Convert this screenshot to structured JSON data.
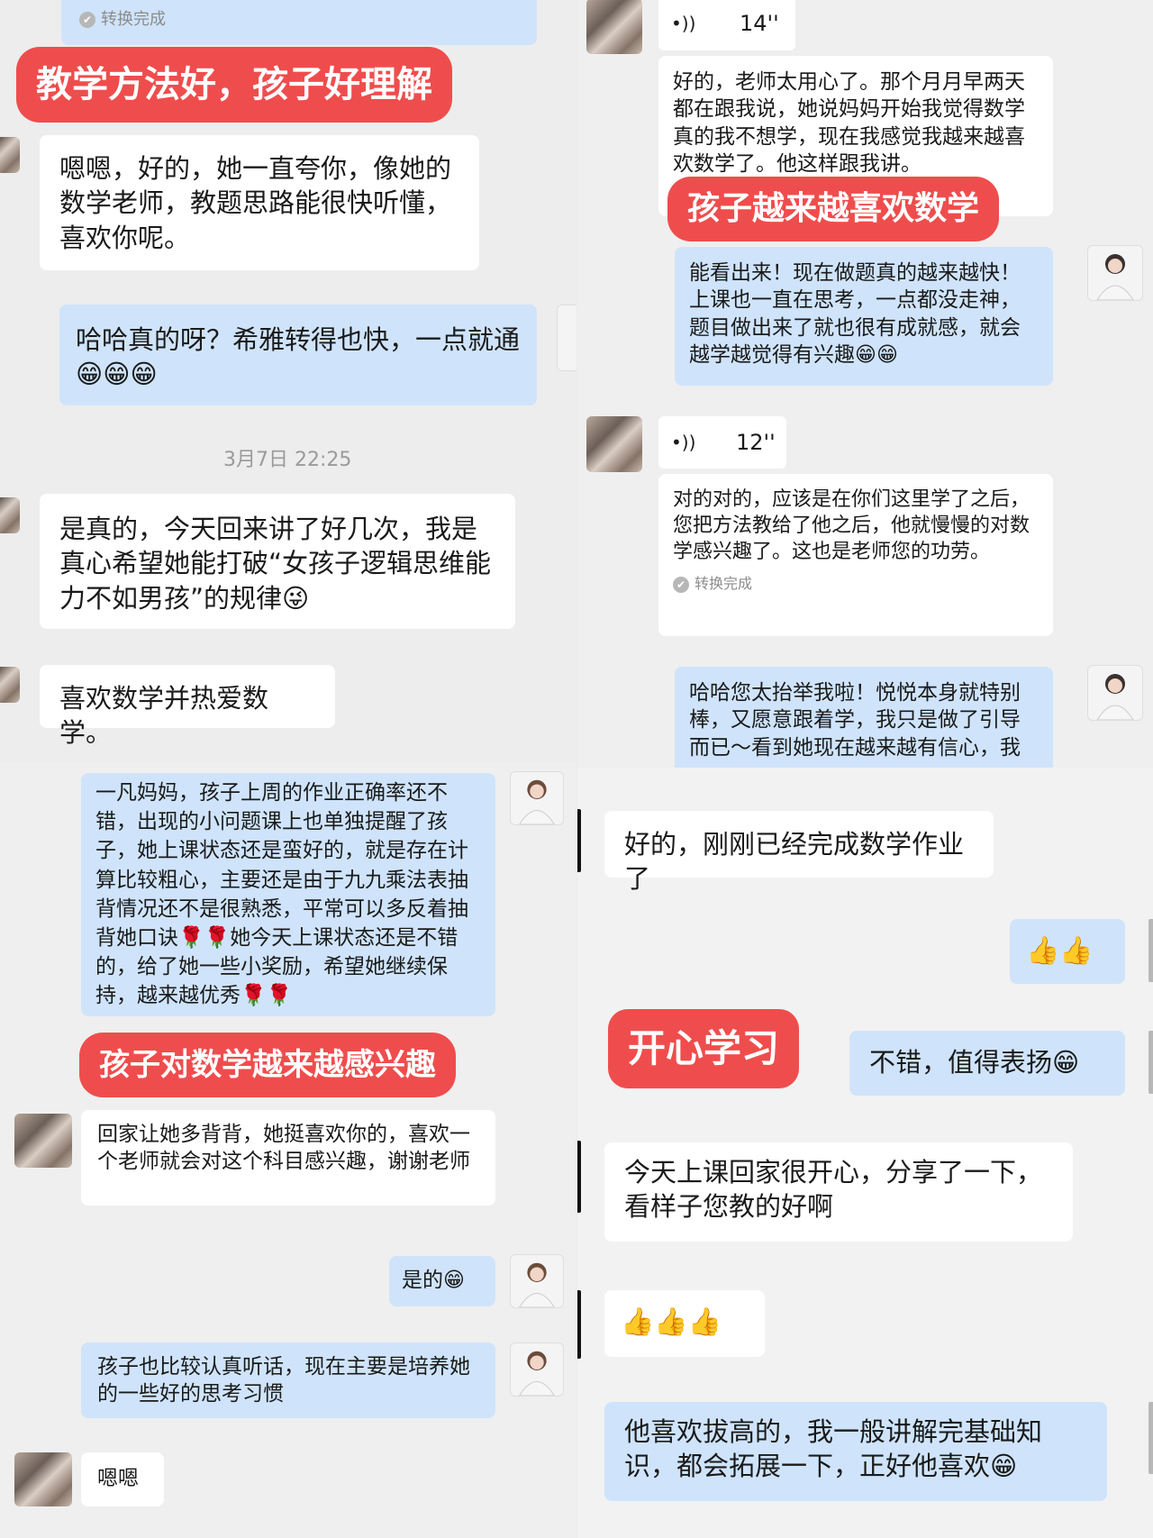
{
  "tl": {
    "conversion_done": "转换完成",
    "tag_method": "教学方法好，孩子好理解",
    "msg_praise": "嗯嗯，好的，她一直夸你，像她的数学老师，教题思路能很快听懂，喜欢你呢。",
    "msg_fast": "哈哈真的呀？希雅转得也快，一点就通😁😁😁",
    "timestamp": "3月7日 22:25",
    "msg_really": "是真的，今天回来讲了好几次，我是真心希望她能打破“女孩子逻辑思维能力不如男孩”的规律😜",
    "msg_love_math": "喜欢数学并热爱数学。"
  },
  "tr": {
    "voice1_duration": "14''",
    "msg_voice1_text": "好的，老师太用心了。那个月月早两天都在跟我说，她说妈妈开始我觉得数学真的我不想学，现在我感觉我越来越喜欢数学了。他这样跟我讲。",
    "tag_love_math": "孩子越来越喜欢数学",
    "msg_teacher_faster": "能看出来！现在做题真的越来越快！上课也一直在思考，一点都没走神，题目做出来了就也很有成就感，就会越学越觉得有兴趣😁😁",
    "voice2_duration": "12''",
    "msg_voice2_text": "对的对的，应该是在你们这里学了之后，您把方法教给了他之后，他就慢慢的对数学感兴趣了。这也是老师您的功劳。",
    "conversion_done": "转换完成",
    "msg_teacher_flattered": "哈哈您太抬举我啦！悦悦本身就特别棒，又愿意跟着学，我只是做了引导而已～看到她现在越来越有信心，我"
  },
  "bl": {
    "msg_homework_report": "一凡妈妈，孩子上周的作业正确率还不错，出现的小问题课上也单独提醒了孩子，她上课状态还是蛮好的，就是存在计算比较粗心，主要还是由于九九乘法表抽背情况还不是很熟悉，平常可以多反着抽背她口诀🌹🌹她今天上课状态还是不错的，给了她一些小奖励，希望她继续保持，越来越优秀🌹🌹",
    "tag_interest": "孩子对数学越来越感兴趣",
    "msg_recite": "回家让她多背背，她挺喜欢你的，喜欢一个老师就会对这个科目感兴趣，谢谢老师",
    "msg_yes": "是的😁",
    "msg_habits": "孩子也比较认真听话，现在主要是培养她的一些好的思考习惯",
    "msg_ok": "嗯嗯"
  },
  "br": {
    "msg_homework_done": "好的，刚刚已经完成数学作业了",
    "msg_thumbs_two": "👍👍",
    "tag_happy": "开心学习",
    "msg_praise_worthy": "不错，值得表扬😁",
    "msg_happy_share": "今天上课回家很开心，分享了一下，看样子您教的好啊",
    "msg_thumbs_three": "👍👍👍",
    "msg_extension": "他喜欢拔高的，我一般讲解完基础知识，都会拓展一下，正好他喜欢😁"
  },
  "icons": {
    "check": "✔",
    "voice": "•))",
    "teacher_avatar": "teacher-avatar",
    "parent_avatar": "blurred-parent-avatar"
  }
}
